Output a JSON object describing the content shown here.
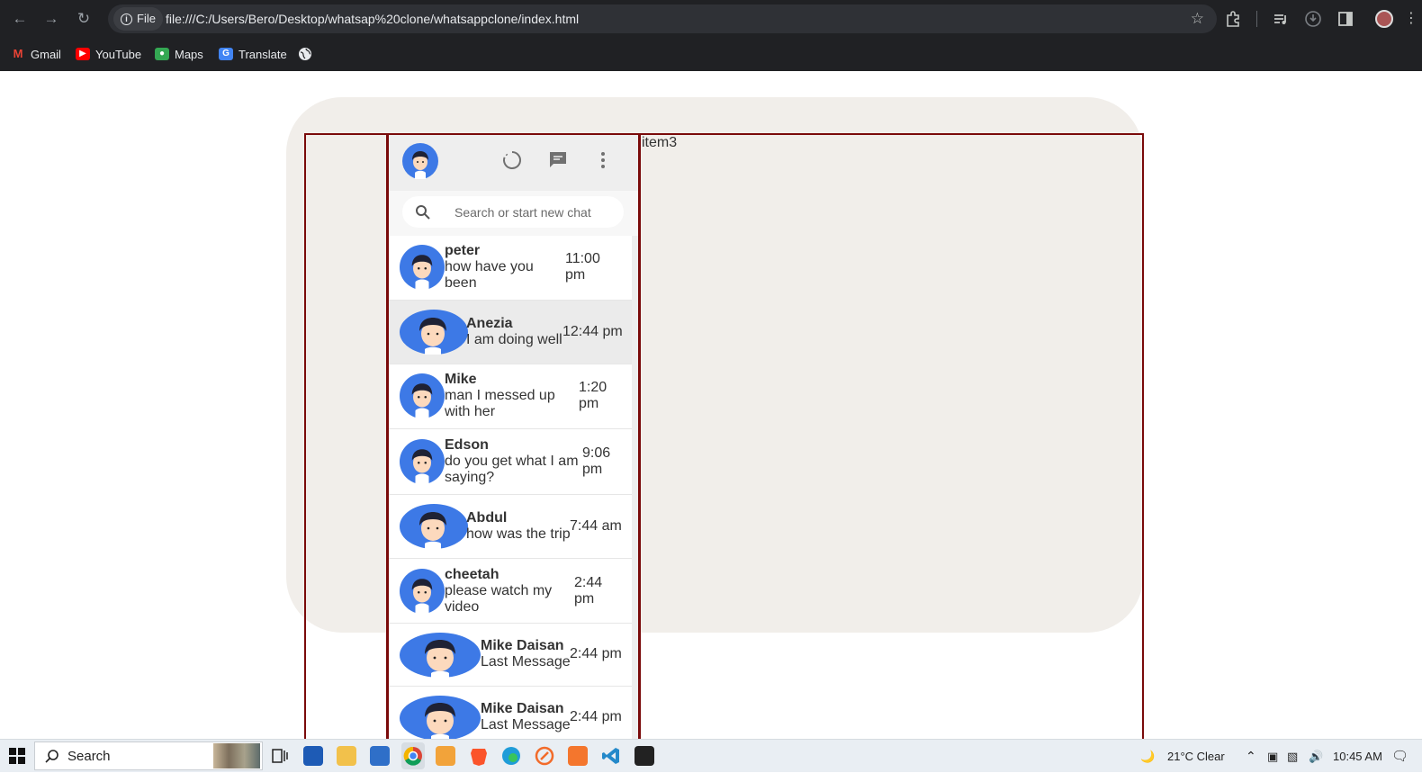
{
  "browser": {
    "chip_label": "File",
    "url": "file:///C:/Users/Bero/Desktop/whatsap%20clone/whatsappclone/index.html",
    "bookmarks": [
      {
        "label": "Gmail",
        "color": "#ea4335"
      },
      {
        "label": "YouTube",
        "color": "#ff0000"
      },
      {
        "label": "Maps",
        "color": "#34a853"
      },
      {
        "label": "Translate",
        "color": "#4285f4"
      }
    ]
  },
  "page": {
    "item3_label": "item3",
    "search": {
      "placeholder": "Search or start new chat"
    },
    "chats": [
      {
        "name": "peter",
        "message": "how have you been",
        "time": "11:00 pm"
      },
      {
        "name": "Anezia",
        "message": "I am doing well",
        "time": "12:44 pm"
      },
      {
        "name": "Mike",
        "message": "man I messed up with her",
        "time": "1:20 pm"
      },
      {
        "name": "Edson",
        "message": "do you get what I am saying?",
        "time": "9:06 pm"
      },
      {
        "name": "Abdul",
        "message": "how was the trip",
        "time": "7:44 am"
      },
      {
        "name": "cheetah",
        "message": "please watch my video",
        "time": "2:44 pm"
      },
      {
        "name": "Mike Daisan",
        "message": "Last Message",
        "time": "2:44 pm"
      },
      {
        "name": "Mike Daisan",
        "message": "Last Message",
        "time": "2:44 pm"
      }
    ]
  },
  "taskbar": {
    "search_label": "Search",
    "weather": "21°C  Clear",
    "clock": "10:45 AM"
  },
  "colors": {
    "accent_border": "#7a0a0a",
    "avatar_blue": "#3d79e6",
    "page_background": "#f1eeea"
  }
}
